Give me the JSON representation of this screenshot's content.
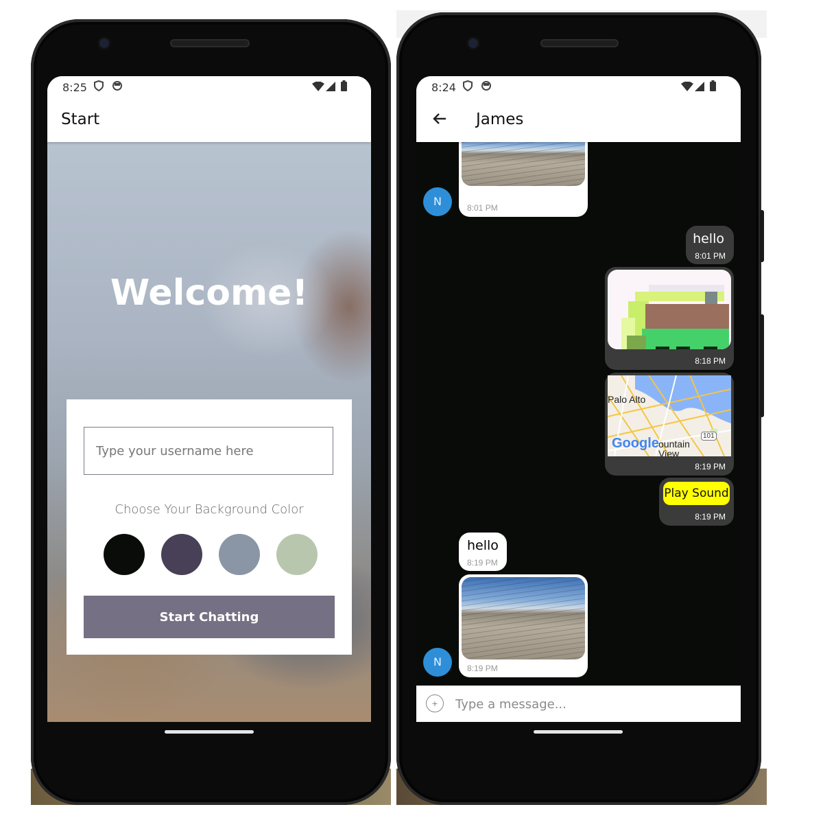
{
  "start_screen": {
    "status_time": "8:25",
    "appbar_title": "Start",
    "welcome_text": "Welcome!",
    "username_placeholder": "Type your username here",
    "color_label": "Choose Your Background Color",
    "colors": [
      "#090c08",
      "#474056",
      "#8a95a5",
      "#b9c6ae"
    ],
    "start_button_label": "Start Chatting",
    "start_button_color": "#757083"
  },
  "chat_screen": {
    "status_time": "8:24",
    "appbar_title": "James",
    "background_color": "#090c08",
    "avatar_initial": "N",
    "messages": [
      {
        "side": "left",
        "type": "image",
        "time": "8:01 PM"
      },
      {
        "side": "right",
        "type": "text",
        "text": "hello",
        "time": "8:01 PM"
      },
      {
        "side": "right",
        "type": "image",
        "time": "8:18 PM"
      },
      {
        "side": "right",
        "type": "map",
        "map_labels": [
          "Palo Alto",
          "Google",
          "ountain",
          "View",
          "101"
        ],
        "time": "8:19 PM"
      },
      {
        "side": "right",
        "type": "audio",
        "button_label": "Play Sound",
        "time": "8:19 PM"
      },
      {
        "side": "left",
        "type": "text",
        "text": "hello",
        "time": "8:19 PM"
      },
      {
        "side": "left",
        "type": "image",
        "time": "8:19 PM"
      }
    ],
    "message_placeholder": "Type a message...",
    "plus_icon": "+"
  }
}
